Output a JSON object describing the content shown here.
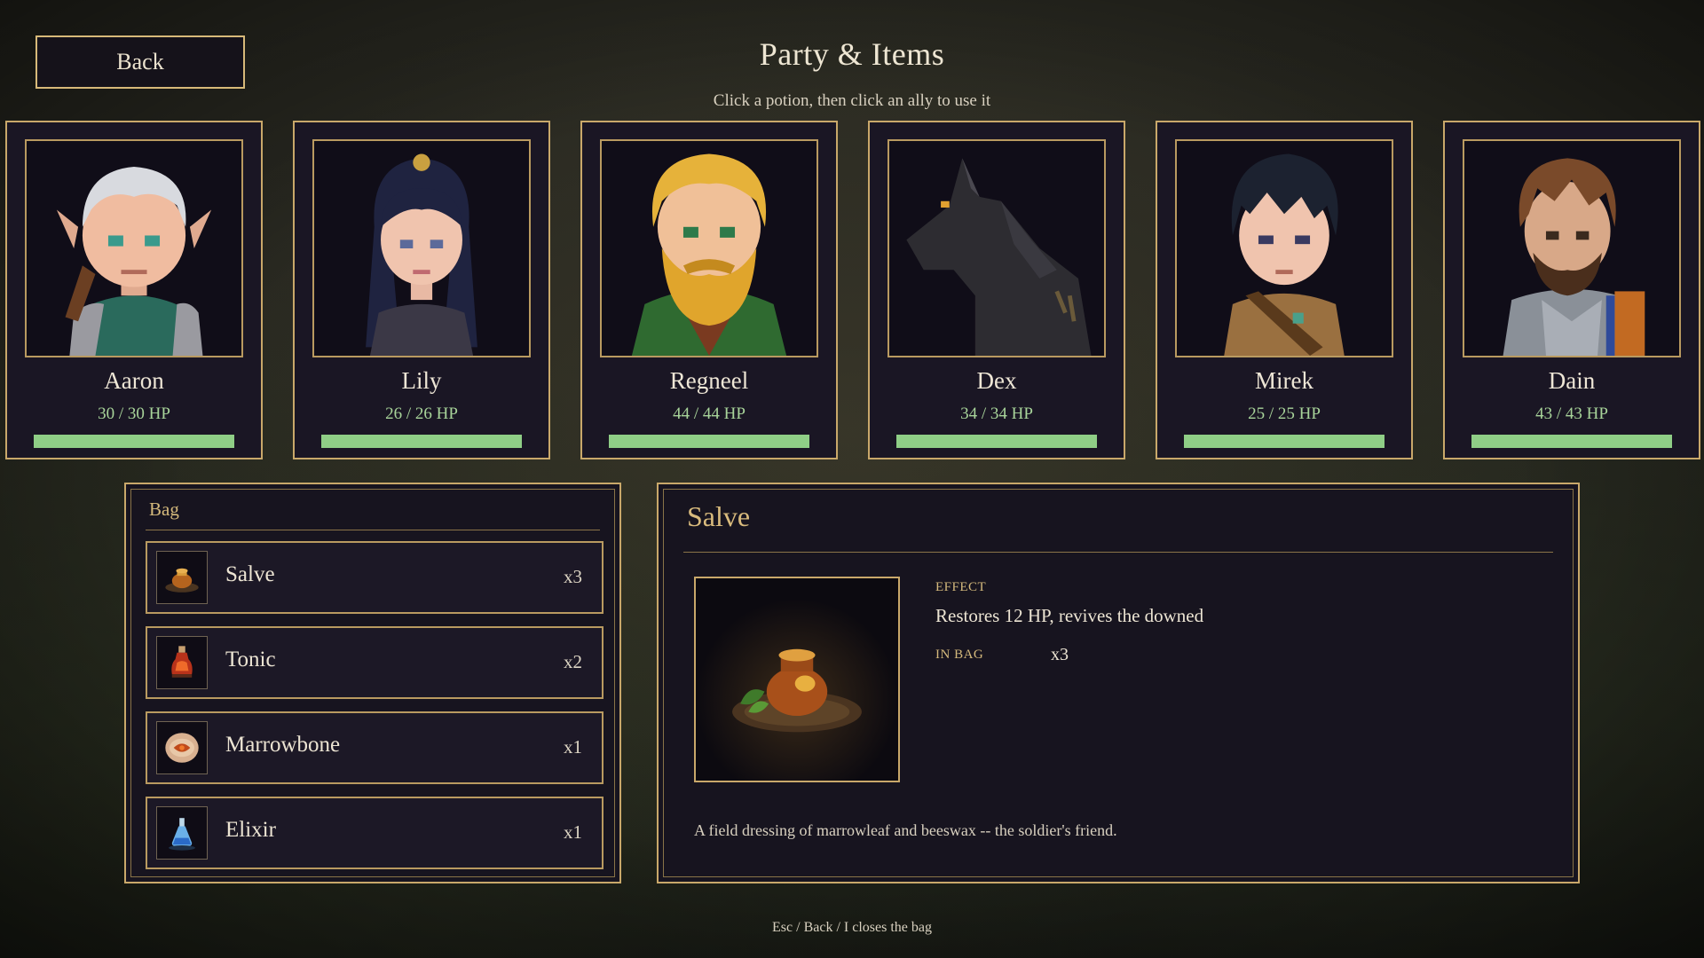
{
  "header": {
    "back_label": "Back",
    "title": "Party & Items",
    "subtitle": "Click a potion, then click an ally to use it"
  },
  "party": [
    {
      "name": "Aaron",
      "hp": "30 / 30  HP",
      "hp_fraction": 1.0,
      "portrait_icon": "elf-archer-portrait"
    },
    {
      "name": "Lily",
      "hp": "26 / 26  HP",
      "hp_fraction": 1.0,
      "portrait_icon": "dark-haired-woman-portrait"
    },
    {
      "name": "Regneel",
      "hp": "44 / 44  HP",
      "hp_fraction": 1.0,
      "portrait_icon": "blond-bearded-man-portrait"
    },
    {
      "name": "Dex",
      "hp": "34 / 34  HP",
      "hp_fraction": 1.0,
      "portrait_icon": "black-wolf-portrait"
    },
    {
      "name": "Mirek",
      "hp": "25 / 25  HP",
      "hp_fraction": 1.0,
      "portrait_icon": "young-boy-portrait"
    },
    {
      "name": "Dain",
      "hp": "43 / 43  HP",
      "hp_fraction": 1.0,
      "portrait_icon": "armored-knight-portrait"
    }
  ],
  "bag": {
    "title": "Bag",
    "items": [
      {
        "name": "Salve",
        "qty": "x3",
        "icon": "salve-pot-icon"
      },
      {
        "name": "Tonic",
        "qty": "x2",
        "icon": "red-potion-icon"
      },
      {
        "name": "Marrowbone",
        "qty": "x1",
        "icon": "marrowbone-icon"
      },
      {
        "name": "Elixir",
        "qty": "x1",
        "icon": "blue-flask-icon"
      }
    ]
  },
  "detail": {
    "title": "Salve",
    "effect_label": "EFFECT",
    "effect_text": "Restores 12 HP, revives the downed",
    "in_bag_label": "IN BAG",
    "in_bag_value": "x3",
    "flavor": "A field dressing of marrowleaf and beeswax -- the soldier's friend.",
    "image_icon": "salve-pot-image"
  },
  "footer": {
    "hint": "Esc / Back / I closes the bag"
  },
  "colors": {
    "accent_gold": "#c9a86a",
    "hp_green": "#8fce86",
    "panel_bg": "#17141f"
  }
}
